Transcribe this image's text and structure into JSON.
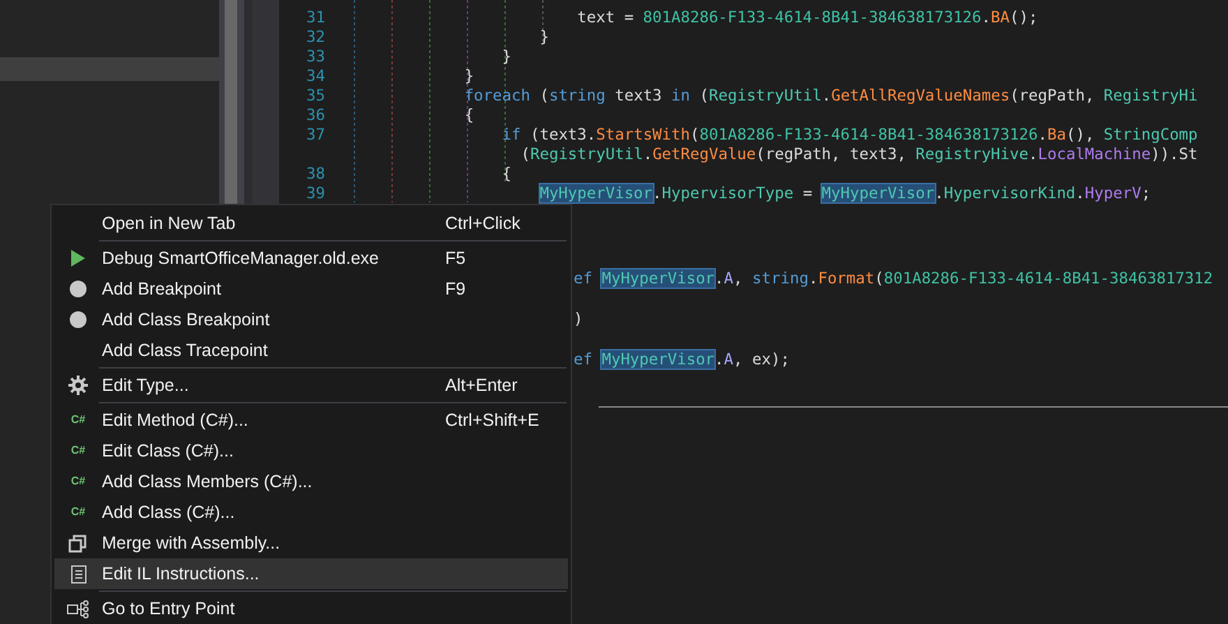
{
  "code_lines": [
    {
      "kind": "numbered",
      "number": "31",
      "tokens": [
        {
          "kind": "plain",
          "text": "text = "
        },
        {
          "kind": "literal",
          "text": "801A8286-F133-4614-8B41-384638173126"
        },
        {
          "kind": "plain",
          "text": "."
        },
        {
          "kind": "method",
          "text": "BA"
        },
        {
          "kind": "plain",
          "text": "();"
        }
      ]
    },
    {
      "kind": "numbered",
      "number": "32",
      "tokens": [
        {
          "kind": "plain",
          "text": "}"
        }
      ]
    },
    {
      "kind": "numbered",
      "number": "33",
      "tokens": [
        {
          "kind": "plain",
          "text": "}"
        }
      ]
    },
    {
      "kind": "numbered",
      "number": "34",
      "tokens": [
        {
          "kind": "plain",
          "text": "}"
        }
      ]
    },
    {
      "kind": "numbered",
      "number": "35",
      "tokens": [
        {
          "kind": "keyword",
          "text": "foreach"
        },
        {
          "kind": "plain",
          "text": " ("
        },
        {
          "kind": "keyword",
          "text": "string"
        },
        {
          "kind": "plain",
          "text": " text3 "
        },
        {
          "kind": "keyword",
          "text": "in"
        },
        {
          "kind": "plain",
          "text": " ("
        },
        {
          "kind": "type",
          "text": "RegistryUtil"
        },
        {
          "kind": "plain",
          "text": "."
        },
        {
          "kind": "method",
          "text": "GetAllRegValueNames"
        },
        {
          "kind": "plain",
          "text": "(regPath, "
        },
        {
          "kind": "type",
          "text": "RegistryHi"
        }
      ]
    },
    {
      "kind": "numbered",
      "number": "36",
      "tokens": [
        {
          "kind": "plain",
          "text": "{"
        }
      ]
    },
    {
      "kind": "numbered",
      "number": "37",
      "tokens": [
        {
          "kind": "keyword",
          "text": "if"
        },
        {
          "kind": "plain",
          "text": " (text3."
        },
        {
          "kind": "method",
          "text": "StartsWith"
        },
        {
          "kind": "plain",
          "text": "("
        },
        {
          "kind": "literal",
          "text": "801A8286-F133-4614-8B41-384638173126"
        },
        {
          "kind": "plain",
          "text": "."
        },
        {
          "kind": "method",
          "text": "Ba"
        },
        {
          "kind": "plain",
          "text": "(), "
        },
        {
          "kind": "type",
          "text": "StringComp"
        }
      ]
    },
    {
      "kind": "continuation",
      "tokens": [
        {
          "kind": "plain",
          "text": "("
        },
        {
          "kind": "type",
          "text": "RegistryUtil"
        },
        {
          "kind": "plain",
          "text": "."
        },
        {
          "kind": "method",
          "text": "GetRegValue"
        },
        {
          "kind": "plain",
          "text": "(regPath, text3, "
        },
        {
          "kind": "type",
          "text": "RegistryHive"
        },
        {
          "kind": "plain",
          "text": "."
        },
        {
          "kind": "enum",
          "text": "LocalMachine"
        },
        {
          "kind": "plain",
          "text": ")).St"
        }
      ]
    },
    {
      "kind": "numbered",
      "number": "38",
      "tokens": [
        {
          "kind": "plain",
          "text": "{"
        }
      ]
    },
    {
      "kind": "numbered",
      "number": "39",
      "tokens": [
        {
          "kind": "reference",
          "text": "MyHyperVisor"
        },
        {
          "kind": "plain",
          "text": "."
        },
        {
          "kind": "type",
          "text": "HypervisorType"
        },
        {
          "kind": "plain",
          "text": " = "
        },
        {
          "kind": "reference",
          "text": "MyHyperVisor"
        },
        {
          "kind": "plain",
          "text": "."
        },
        {
          "kind": "type",
          "text": "HypervisorKind"
        },
        {
          "kind": "plain",
          "text": "."
        },
        {
          "kind": "enum",
          "text": "HyperV"
        },
        {
          "kind": "plain",
          "text": ";"
        }
      ]
    },
    {
      "kind": "partial",
      "tokens": [
        {
          "kind": "keyword",
          "text": "ef "
        },
        {
          "kind": "reference",
          "text": "MyHyperVisor"
        },
        {
          "kind": "plain",
          "text": "."
        },
        {
          "kind": "field",
          "text": "A"
        },
        {
          "kind": "plain",
          "text": ", "
        },
        {
          "kind": "keyword",
          "text": "string"
        },
        {
          "kind": "plain",
          "text": "."
        },
        {
          "kind": "method",
          "text": "Format"
        },
        {
          "kind": "plain",
          "text": "("
        },
        {
          "kind": "literal",
          "text": "801A8286-F133-4614-8B41-38463817312"
        }
      ]
    },
    {
      "kind": "partial",
      "tokens": [
        {
          "kind": "plain",
          "text": ")"
        }
      ]
    },
    {
      "kind": "partial",
      "tokens": [
        {
          "kind": "keyword",
          "text": "ef "
        },
        {
          "kind": "reference",
          "text": "MyHyperVisor"
        },
        {
          "kind": "plain",
          "text": "."
        },
        {
          "kind": "field",
          "text": "A"
        },
        {
          "kind": "plain",
          "text": ", ex);"
        }
      ]
    }
  ],
  "context_menu": {
    "items": [
      {
        "kind": "plain",
        "label": "Open in New Tab",
        "shortcut": "Ctrl+Click",
        "separator_before": false,
        "hovered": false
      },
      {
        "kind": "debug",
        "label": "Debug SmartOfficeManager.old.exe",
        "shortcut": "F5",
        "separator_before": true,
        "hovered": false
      },
      {
        "kind": "breakpoint",
        "label": "Add Breakpoint",
        "shortcut": "F9",
        "separator_before": false,
        "hovered": false
      },
      {
        "kind": "breakpoint",
        "label": "Add Class Breakpoint",
        "separator_before": false,
        "hovered": false
      },
      {
        "kind": "plain",
        "label": "Add Class Tracepoint",
        "separator_before": false,
        "hovered": false
      },
      {
        "kind": "settings",
        "label": "Edit Type...",
        "shortcut": "Alt+Enter",
        "separator_before": true,
        "hovered": false
      },
      {
        "kind": "csharp",
        "badge": "C#",
        "label": "Edit Method (C#)...",
        "shortcut": "Ctrl+Shift+E",
        "separator_before": true,
        "hovered": false
      },
      {
        "kind": "csharp",
        "badge": "C#",
        "label": "Edit Class (C#)...",
        "separator_before": false,
        "hovered": false
      },
      {
        "kind": "csharp",
        "badge": "C#",
        "label": "Add Class Members (C#)...",
        "separator_before": false,
        "hovered": false
      },
      {
        "kind": "csharp",
        "badge": "C#",
        "label": "Add Class (C#)...",
        "separator_before": false,
        "hovered": false
      },
      {
        "kind": "merge",
        "label": "Merge with Assembly...",
        "separator_before": false,
        "hovered": false
      },
      {
        "kind": "instructions",
        "label": "Edit IL Instructions...",
        "separator_before": false,
        "hovered": true
      },
      {
        "kind": "entry",
        "label": "Go to Entry Point",
        "separator_before": true,
        "hovered": false
      }
    ]
  }
}
